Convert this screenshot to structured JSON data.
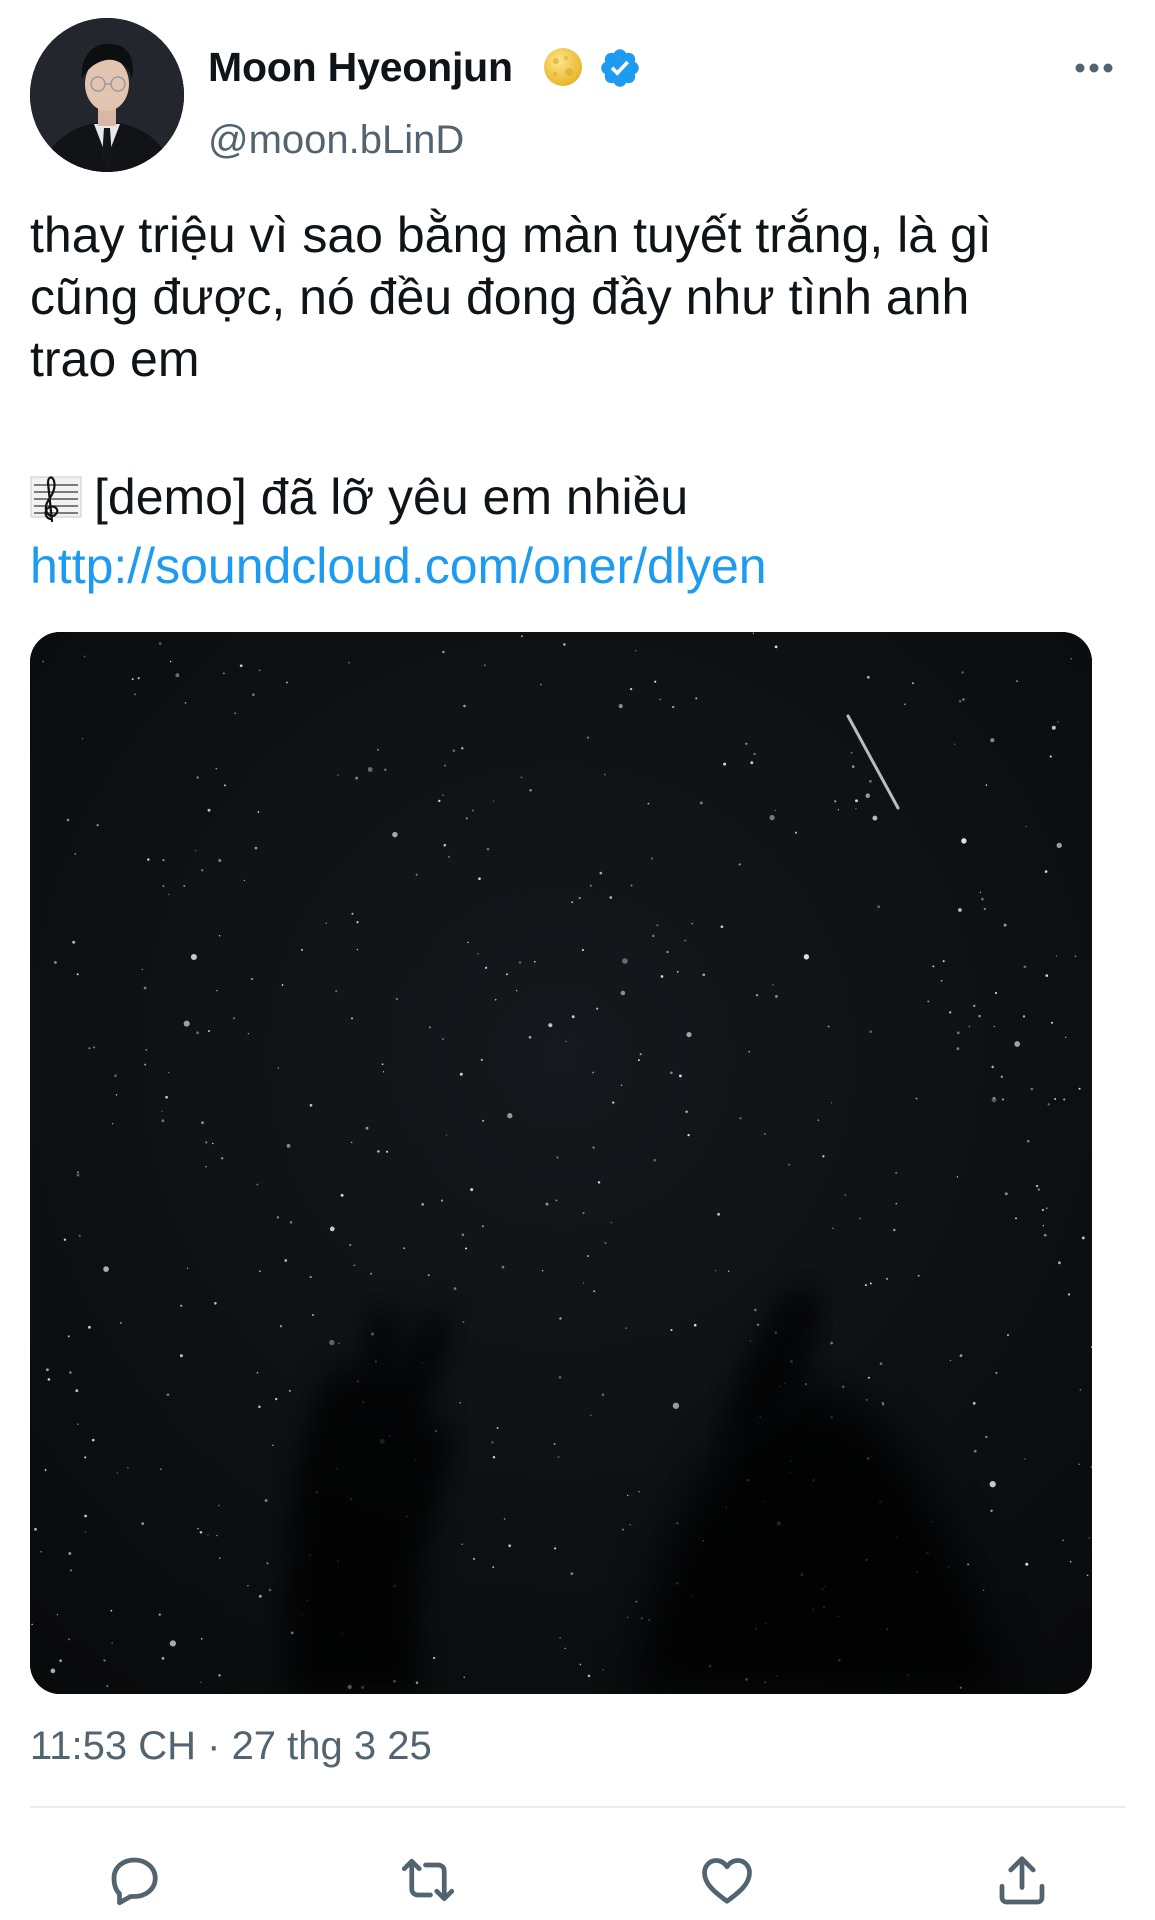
{
  "tweet": {
    "author": {
      "display_name": "Moon Hyeonjun",
      "handle": "@moon.bLinD",
      "verified": true,
      "badge_icons": [
        "moon-emoji-icon",
        "verified-badge-icon"
      ]
    },
    "text_lines": [
      "thay triệu vì sao bằng màn tuyết trắng, là gì",
      "cũng được, nó đều đong đầy như tình anh",
      "trao em"
    ],
    "track": {
      "icon": "music-score-icon",
      "title": "[demo] đã lỡ yêu em nhiều"
    },
    "link": "http://soundcloud.com/oner/dlyen",
    "media": {
      "icon": "night-sky-photo"
    },
    "timestamp": "11:53 CH · 27 thg 3 25"
  },
  "actions": {
    "icons": [
      "reply-icon",
      "retweet-icon",
      "like-icon",
      "share-icon"
    ]
  },
  "colors": {
    "text": "#0f1419",
    "secondary": "#536471",
    "link": "#1d9bf0",
    "verified": "#1d9bf0",
    "divider": "#e6ecf0"
  }
}
